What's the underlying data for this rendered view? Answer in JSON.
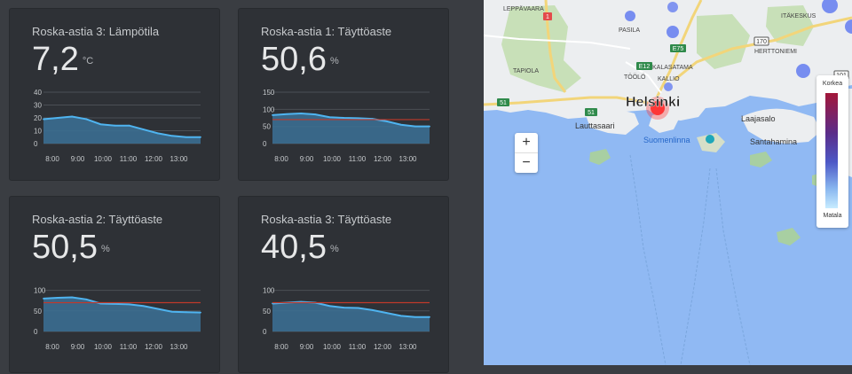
{
  "cards": [
    {
      "title": "Roska-astia 3: Lämpötila",
      "value": "7,2",
      "unit": "°C",
      "y_ticks": [
        "40",
        "30",
        "20",
        "10",
        "0"
      ],
      "x_ticks": [
        "8:00",
        "9:00",
        "10:00",
        "11:00",
        "12:00",
        "13:00"
      ]
    },
    {
      "title": "Roska-astia 1: Täyttöaste",
      "value": "50,6",
      "unit": "%",
      "y_ticks": [
        "150",
        "100",
        "50",
        "0"
      ],
      "x_ticks": [
        "8:00",
        "9:00",
        "10:00",
        "11:00",
        "12:00",
        "13:00"
      ]
    },
    {
      "title": "Roska-astia 2: Täyttöaste",
      "value": "50,5",
      "unit": "%",
      "y_ticks": [
        "100",
        "50",
        "0"
      ],
      "x_ticks": [
        "8:00",
        "9:00",
        "10:00",
        "11:00",
        "12:00",
        "13:00"
      ]
    },
    {
      "title": "Roska-astia 3: Täyttöaste",
      "value": "40,5",
      "unit": "%",
      "y_ticks": [
        "100",
        "50",
        "0"
      ],
      "x_ticks": [
        "8:00",
        "9:00",
        "10:00",
        "11:00",
        "12:00",
        "13:00"
      ]
    }
  ],
  "chart_data": [
    {
      "type": "area",
      "x": [
        "8:00",
        "8:30",
        "9:00",
        "9:30",
        "10:00",
        "10:30",
        "11:00",
        "11:30",
        "12:00",
        "12:30",
        "13:00",
        "13:30"
      ],
      "values": [
        19,
        20,
        21,
        19,
        15,
        14,
        14,
        11,
        8,
        6,
        5,
        5
      ],
      "ylim": [
        0,
        40
      ],
      "threshold": null
    },
    {
      "type": "area",
      "x": [
        "8:00",
        "8:30",
        "9:00",
        "9:30",
        "10:00",
        "10:30",
        "11:00",
        "11:30",
        "12:00",
        "12:30",
        "13:00",
        "13:30"
      ],
      "values": [
        83,
        86,
        88,
        85,
        77,
        75,
        74,
        72,
        65,
        55,
        50,
        50
      ],
      "ylim": [
        0,
        150
      ],
      "threshold": 70
    },
    {
      "type": "area",
      "x": [
        "8:00",
        "8:30",
        "9:00",
        "9:30",
        "10:00",
        "10:30",
        "11:00",
        "11:30",
        "12:00",
        "12:30",
        "13:00",
        "13:30"
      ],
      "values": [
        80,
        82,
        83,
        78,
        68,
        67,
        66,
        62,
        55,
        48,
        47,
        46
      ],
      "ylim": [
        0,
        125
      ],
      "threshold": 70
    },
    {
      "type": "area",
      "x": [
        "8:00",
        "8:30",
        "9:00",
        "9:30",
        "10:00",
        "10:30",
        "11:00",
        "11:30",
        "12:00",
        "12:30",
        "13:00",
        "13:30"
      ],
      "values": [
        68,
        70,
        72,
        70,
        62,
        58,
        57,
        52,
        45,
        38,
        35,
        35
      ],
      "ylim": [
        0,
        125
      ],
      "threshold": 70
    }
  ],
  "colors": {
    "line": "#4fb4f0",
    "fill": "#3b6e91",
    "threshold": "#c0392b",
    "grid": "#4b4f55"
  },
  "map": {
    "labels": {
      "helsinki": "Helsinki",
      "leppavaara": "LEPPÄVAARA",
      "pasila": "PASILA",
      "tapiola": "TAPIOLA",
      "kalasatama": "KALASATAMA",
      "toolo": "TÖÖLÖ",
      "kallio": "KALLIO",
      "lauttasaari": "Lauttasaari",
      "suomenlinna": "Suomenlinna",
      "laajasalo": "Laajasalo",
      "santahamina": "Santahamina",
      "herttoniemi": "HERTTONIEMI",
      "itakeskus": "ITÄKESKUS"
    },
    "shields": {
      "e75": "E75",
      "e12": "E12",
      "r51a": "51",
      "r51b": "51",
      "r170": "170",
      "r101": "101",
      "r1": "1"
    },
    "zoom_in": "+",
    "zoom_out": "−",
    "legend": {
      "high": "Korkea",
      "low": "Matala"
    }
  }
}
